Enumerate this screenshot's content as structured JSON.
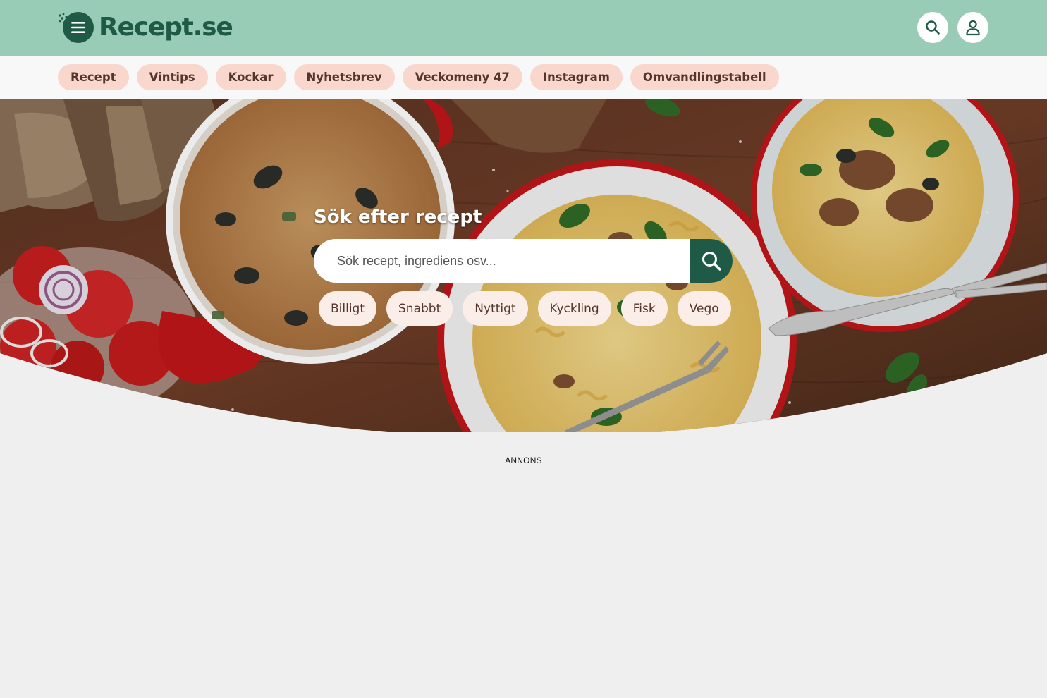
{
  "header": {
    "logo_text": "Recept.se",
    "logo_icon": "menu-icon",
    "search_icon": "search-icon",
    "user_icon": "user-icon",
    "brand_color": "#1f5a46",
    "bar_color": "#99ccb6"
  },
  "nav": {
    "items": [
      {
        "label": "Recept"
      },
      {
        "label": "Vintips"
      },
      {
        "label": "Kockar"
      },
      {
        "label": "Nyhetsbrev"
      },
      {
        "label": "Veckomeny 47"
      },
      {
        "label": "Instagram"
      },
      {
        "label": "Omvandlingstabell"
      }
    ],
    "chip_color": "#f9d7cc"
  },
  "hero": {
    "title": "Sök efter recept",
    "search_placeholder": "Sök recept, ingrediens osv...",
    "search_button_icon": "search-icon",
    "quick_filters": [
      {
        "label": "Billigt"
      },
      {
        "label": "Snabbt"
      },
      {
        "label": "Nyttigt"
      },
      {
        "label": "Kyckling"
      },
      {
        "label": "Fisk"
      },
      {
        "label": "Vego"
      }
    ]
  },
  "ad": {
    "label": "ANNONS"
  }
}
